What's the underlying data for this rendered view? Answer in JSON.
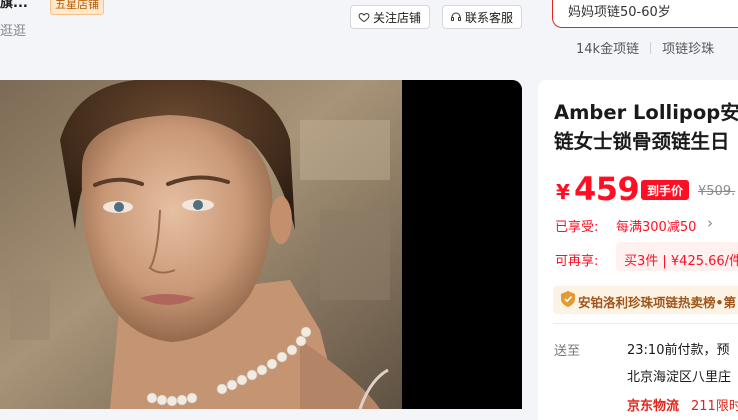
{
  "shop": {
    "name": "旗...",
    "star_badge": "五星店铺",
    "sub": "逛逛",
    "follow_label": "关注店铺",
    "service_label": "联系客服"
  },
  "search": {
    "value": "妈妈项链50-60岁",
    "hot_words": [
      "14k金项链",
      "项链珍珠"
    ]
  },
  "product": {
    "title_line1": "Amber Lollipop安",
    "title_line2": "链女士锁骨颈链生日",
    "price_symbol": "¥",
    "price": "459",
    "price_tag": "到手价",
    "original_price": "¥509.",
    "enjoyed_label": "已享受:",
    "enjoyed_value": "每满300减50",
    "more_label": "可再享:",
    "more_value": "买3件 | ¥425.66/件",
    "rank_text": "安铂洛利珍珠项链热卖榜•第",
    "ship_label": "送至",
    "ship_time": "23:10前付款，预",
    "ship_address": "北京海淀区八里庄",
    "logistics": "京东物流",
    "logistics_note": "211限时"
  },
  "colors": {
    "accent": "#ff0f23",
    "badge_bg": "#ffe8cc",
    "rank_bg": "#fdf3e4"
  }
}
